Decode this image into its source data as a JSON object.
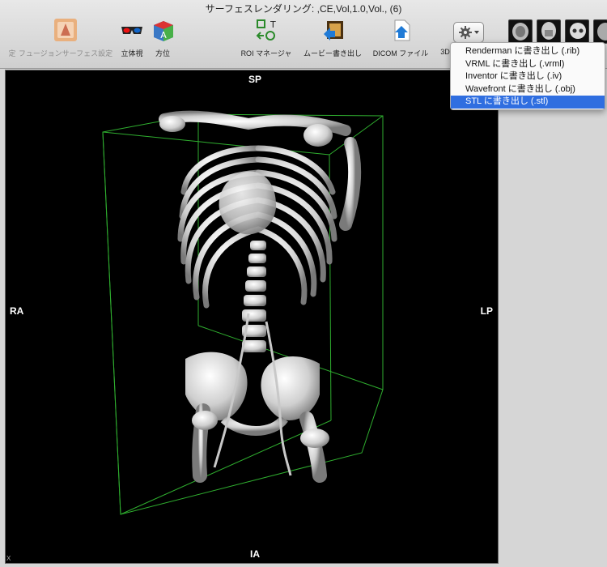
{
  "window": {
    "title": "サーフェスレンダリング: ,CE,Vol,1.0,Vol., (6)"
  },
  "toolbar": {
    "cut_label": "定",
    "fusion_label": "フュージョンサーフェス設定",
    "stereo_label": "立体視",
    "orientation_label": "方位",
    "roi_label": "ROI マネージャ",
    "movie_label": "ムービー書き出し",
    "dicom_label": "DICOM ファイル",
    "threed_label": "3D"
  },
  "viewer": {
    "orient_top": "SP",
    "orient_bottom": "IA",
    "orient_left": "RA",
    "orient_right": "LP",
    "corner": "X"
  },
  "menu": {
    "items": [
      "Renderman に書き出し (.rib)",
      "VRML に書き出し (.vrml)",
      "Inventor に書き出し (.iv)",
      "Wavefront に書き出し (.obj)",
      "STL に書き出し (.stl)"
    ],
    "selected_index": 4
  },
  "colors": {
    "accent": "#2f6ee0",
    "bounding_box": "#2fae2f"
  }
}
